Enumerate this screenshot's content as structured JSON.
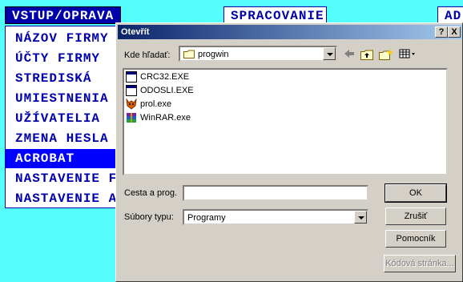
{
  "background_app": {
    "tabs": [
      "VSTUP/OPRAVA",
      "SPRACOVANIE",
      "AD"
    ],
    "menu_items": [
      {
        "label": "NÁZOV FIRMY",
        "selected": false
      },
      {
        "label": "ÚČTY FIRMY",
        "selected": false
      },
      {
        "label": "STREDISKÁ",
        "selected": false
      },
      {
        "label": "UMIESTNENIA",
        "selected": false
      },
      {
        "label": "UŽÍVATELIA",
        "selected": false
      },
      {
        "label": "ZMENA HESLA",
        "selected": false
      },
      {
        "label": "ACROBAT",
        "selected": true
      },
      {
        "label": "NASTAVENIE FI",
        "selected": false
      },
      {
        "label": "NASTAVENIE AR",
        "selected": false
      }
    ]
  },
  "dialog": {
    "title": "Otevřít",
    "help_label": "?",
    "close_label": "X",
    "look_in_label": "Kde hľadať:",
    "look_in_value": "progwin",
    "files": [
      {
        "name": "CRC32.EXE",
        "icon": "exe-icon"
      },
      {
        "name": "ODOSLI.EXE",
        "icon": "exe-icon"
      },
      {
        "name": "prol.exe",
        "icon": "fox-icon"
      },
      {
        "name": "WinRAR.exe",
        "icon": "winrar-icon"
      }
    ],
    "path_label": "Cesta a prog.",
    "path_value": "",
    "types_label": "Súbory typu:",
    "types_value": "Programy",
    "buttons": {
      "ok": "OK",
      "cancel": "Zrušiť",
      "help": "Pomocník",
      "codepage": "Kódová stránka..."
    },
    "colors": {
      "title_start": "#0a246a",
      "title_end": "#a6caf0",
      "face": "#d4d0c8"
    }
  }
}
